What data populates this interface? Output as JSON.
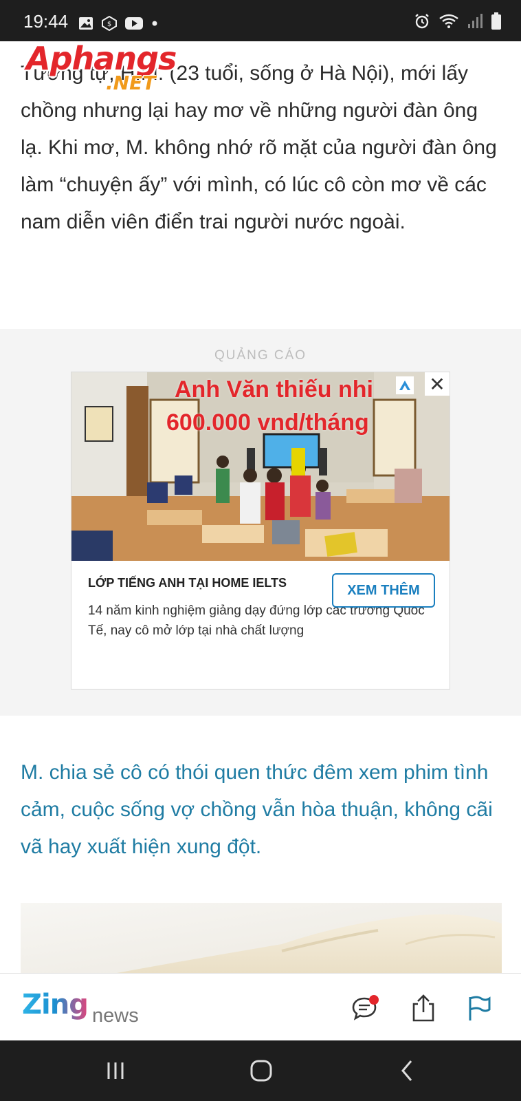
{
  "status_bar": {
    "time": "19:44"
  },
  "watermark": {
    "main": "Aphangs",
    "suffix": ".NET"
  },
  "article": {
    "paragraph1": "Tương tự, H.M. (23 tuổi, sống ở Hà Nội), mới lấy chồng nhưng lại hay mơ về những người đàn ông lạ. Khi mơ, M. không nhớ rõ mặt của người đàn ông làm “chuyện ấy” với mình, có lúc cô còn mơ về các nam diễn viên điển trai người nước ngoài.",
    "paragraph2": "M. chia sẻ cô có thói quen thức đêm xem phim tình cảm, cuộc sống vợ chồng vẫn hòa thuận, không cãi vã hay xuất hiện xung đột."
  },
  "ad": {
    "label": "QUẢNG CÁO",
    "image_headline_line1": "Anh Văn thiếu nhi",
    "image_headline_line2": "600.000 vnd/tháng",
    "close": "✕",
    "title": "LỚP TIẾNG ANH TẠI HOME IELTS",
    "description": "14 năm kinh nghiệm giảng dạy đứng lớp các trường Quốc Tế, nay cô mở lớp tại nhà chất lượng",
    "cta": "XEM THÊM"
  },
  "app_bar": {
    "logo_brand": "Zing",
    "logo_suffix": "news",
    "icons": [
      "comment-icon",
      "share-icon",
      "flag-icon"
    ]
  },
  "nav_bar": {
    "icons": [
      "recent-apps-icon",
      "home-icon",
      "back-icon"
    ]
  },
  "colors": {
    "accent_blue": "#1f7ca3",
    "cta_blue": "#1a7fbf",
    "notification_red": "#e3262b"
  }
}
